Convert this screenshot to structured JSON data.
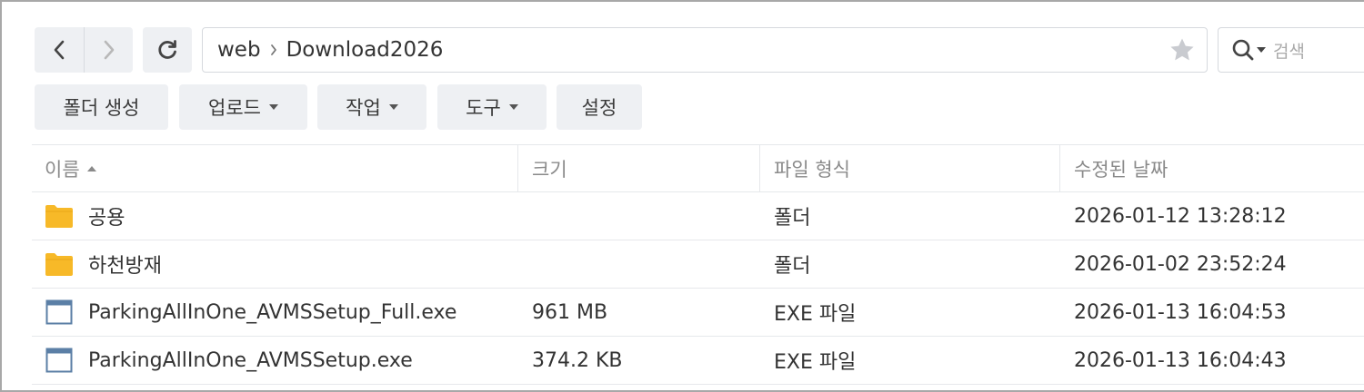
{
  "nav": {
    "back_icon": "chevron-left-icon",
    "forward_icon": "chevron-right-icon",
    "refresh_icon": "refresh-icon"
  },
  "path": {
    "segments": [
      "web",
      "Download2026"
    ],
    "favorite_icon": "star-icon"
  },
  "search": {
    "placeholder": "검색",
    "icon": "search-icon"
  },
  "toolbar": {
    "create_folder": "폴더 생성",
    "upload": "업로드",
    "action": "작업",
    "tools": "도구",
    "settings": "설정"
  },
  "table": {
    "columns": [
      "이름",
      "크기",
      "파일 형식",
      "수정된 날짜"
    ],
    "rows": [
      {
        "icon": "folder-icon",
        "name": "공용",
        "size": "",
        "type": "폴더",
        "modified": "2026-01-12 13:28:12"
      },
      {
        "icon": "folder-icon",
        "name": "하천방재",
        "size": "",
        "type": "폴더",
        "modified": "2026-01-02 23:52:24"
      },
      {
        "icon": "file-icon",
        "name": "ParkingAllInOne_AVMSSetup_Full.exe",
        "size": "961 MB",
        "type": "EXE 파일",
        "modified": "2026-01-13 16:04:53"
      },
      {
        "icon": "file-icon",
        "name": "ParkingAllInOne_AVMSSetup.exe",
        "size": "374.2 KB",
        "type": "EXE 파일",
        "modified": "2026-01-13 16:04:43"
      }
    ]
  },
  "colors": {
    "folder": "#f7b928",
    "button_bg": "#eef0f3",
    "border": "#d6d9de"
  }
}
